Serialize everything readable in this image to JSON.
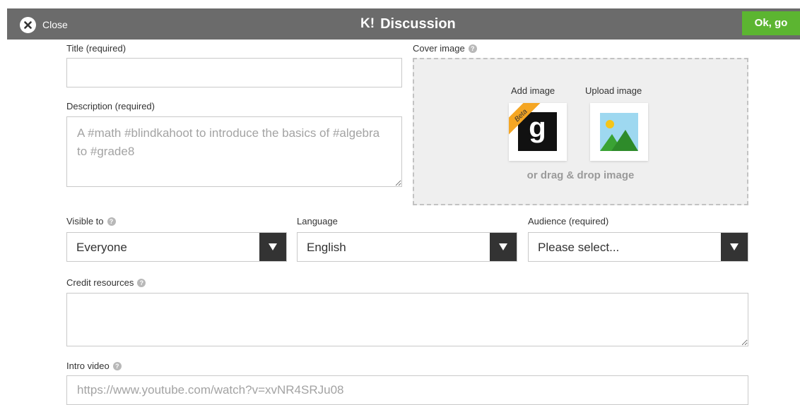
{
  "header": {
    "close_label": "Close",
    "logo_text": "K!",
    "title": "Discussion",
    "ok_label": "Ok, go",
    "bar_color": "#6b6b6b",
    "ok_color": "#5cb531"
  },
  "form": {
    "title": {
      "label": "Title (required)",
      "value": "",
      "placeholder": ""
    },
    "description": {
      "label": "Description (required)",
      "value": "",
      "placeholder": "A #math #blindkahoot to introduce the basics of #algebra to #grade8"
    },
    "cover_image": {
      "label": "Cover image",
      "add_image_label": "Add image",
      "upload_image_label": "Upload image",
      "beta_badge": "Beta",
      "getty_letter": "g",
      "drag_text": "or drag & drop image",
      "icons": [
        "getty-images-icon",
        "image-upload-icon"
      ]
    },
    "visible_to": {
      "label": "Visible to",
      "selected": "Everyone"
    },
    "language": {
      "label": "Language",
      "selected": "English"
    },
    "audience": {
      "label": "Audience (required)",
      "selected": "Please select..."
    },
    "credit_resources": {
      "label": "Credit resources",
      "value": ""
    },
    "intro_video": {
      "label": "Intro video",
      "value": "",
      "placeholder": "https://www.youtube.com/watch?v=xvNR4SRJu08"
    }
  },
  "help_icon_glyph": "?"
}
